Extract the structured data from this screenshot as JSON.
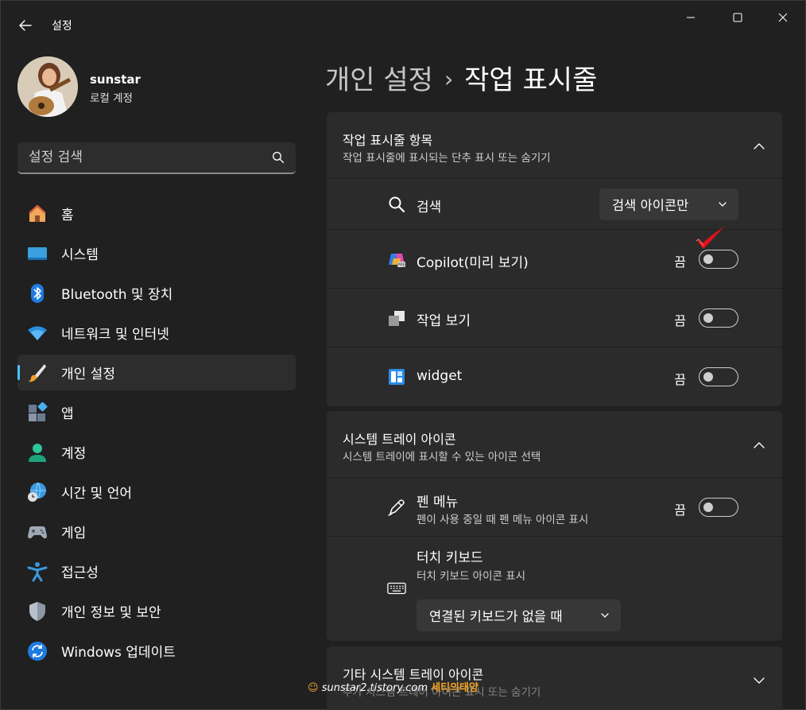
{
  "window": {
    "title": "설정"
  },
  "user": {
    "name": "sunstar",
    "account_type": "로컬 계정"
  },
  "search": {
    "placeholder": "설정 검색"
  },
  "nav": {
    "items": [
      {
        "label": "홈",
        "icon": "home-icon"
      },
      {
        "label": "시스템",
        "icon": "monitor-icon"
      },
      {
        "label": "Bluetooth 및 장치",
        "icon": "bluetooth-icon"
      },
      {
        "label": "네트워크 및 인터넷",
        "icon": "wifi-icon"
      },
      {
        "label": "개인 설정",
        "icon": "brush-icon",
        "selected": true
      },
      {
        "label": "앱",
        "icon": "apps-icon"
      },
      {
        "label": "계정",
        "icon": "person-icon"
      },
      {
        "label": "시간 및 언어",
        "icon": "globe-clock-icon"
      },
      {
        "label": "게임",
        "icon": "gamepad-icon"
      },
      {
        "label": "접근성",
        "icon": "accessibility-icon"
      },
      {
        "label": "개인 정보 및 보안",
        "icon": "shield-icon"
      },
      {
        "label": "Windows 업데이트",
        "icon": "update-icon"
      }
    ]
  },
  "breadcrumb": {
    "parent": "개인 설정",
    "separator": "›",
    "current": "작업 표시줄"
  },
  "taskbar_items": {
    "title": "작업 표시줄 항목",
    "subtitle": "작업 표시줄에 표시되는 단추 표시 또는 숨기기",
    "search": {
      "label": "검색",
      "dropdown_value": "검색 아이콘만"
    },
    "copilot": {
      "label": "Copilot(미리 보기)",
      "state": "끔"
    },
    "task_view": {
      "label": "작업 보기",
      "state": "끔"
    },
    "widget": {
      "label": "widget",
      "state": "끔"
    }
  },
  "system_tray": {
    "title": "시스템 트레이 아이콘",
    "subtitle": "시스템 트레이에 표시할 수 있는 아이콘 선택",
    "pen_menu": {
      "label": "펜 메뉴",
      "sub": "펜이 사용 중일 때 펜 메뉴 아이콘 표시",
      "state": "끔"
    },
    "touch_keyboard": {
      "label": "터치 키보드",
      "sub": "터치 키보드 아이콘 표시",
      "dropdown_value": "연결된 키보드가 없을 때"
    }
  },
  "other_tray": {
    "title": "기타 시스템 트레이 아이콘",
    "subtitle": "추가 시스템 트레이 아이콘 표시 또는 숨기기"
  },
  "watermark": {
    "site": "sunstar2.tistory.com",
    "brand": "세티의태양"
  },
  "colors": {
    "background": "#202020",
    "card": "#2b2b2b",
    "accent": "#4cc2ff",
    "annotation_check": "#e0131b"
  }
}
